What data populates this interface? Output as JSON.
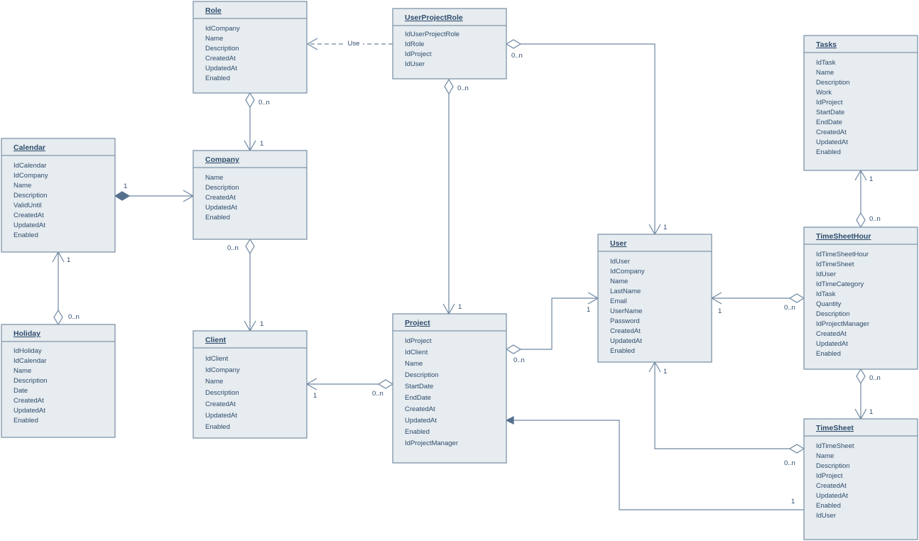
{
  "colors": {
    "box_fill": "#e6ecef",
    "box_border": "#7f95aa",
    "text": "#2e4b6d",
    "connector": "#6d86a0"
  },
  "classes": [
    {
      "id": "role",
      "name": "Role",
      "attributes": [
        "IdCompany",
        "Name",
        "Description",
        "CreatedAt",
        "UpdatedAt",
        "Enabled"
      ]
    },
    {
      "id": "userprojectrole",
      "name": "UserProjectRole",
      "attributes": [
        "IdUserProjectRole",
        "IdRole",
        "IdProject",
        "IdUser"
      ]
    },
    {
      "id": "tasks",
      "name": "Tasks",
      "attributes": [
        "IdTask",
        "Name",
        "Description",
        "Work",
        "IdProject",
        "StartDate",
        "EndDate",
        "CreatedAt",
        "UpdatedAt",
        "Enabled"
      ]
    },
    {
      "id": "calendar",
      "name": "Calendar",
      "attributes": [
        "IdCalendar",
        "IdCompany",
        "Name",
        "Description",
        "ValidUntil",
        "CreatedAt",
        "UpdatedAt",
        "Enabled"
      ]
    },
    {
      "id": "company",
      "name": "Company",
      "attributes": [
        "Name",
        "Description",
        "CreatedAt",
        "UpdatedAt",
        "Enabled"
      ]
    },
    {
      "id": "holiday",
      "name": "Holiday",
      "attributes": [
        "IdHoliday",
        "IdCalendar",
        "Name",
        "Description",
        "Date",
        "CreatedAt",
        "UpdatedAt",
        "Enabled"
      ]
    },
    {
      "id": "client",
      "name": "Client",
      "attributes": [
        "IdClient",
        "IdCompany",
        "Name",
        "Description",
        "CreatedAt",
        "UpdatedAt",
        "Enabled"
      ]
    },
    {
      "id": "project",
      "name": "Project",
      "attributes": [
        "IdProject",
        "IdClient",
        "Name",
        "Description",
        "StartDate",
        "EndDate",
        "CreatedAt",
        "UpdatedAt",
        "Enabled",
        "IdProjectManager"
      ]
    },
    {
      "id": "user",
      "name": "User",
      "attributes": [
        "IdUser",
        "IdCompany",
        "Name",
        "LastName",
        "Email",
        "UserName",
        "Password",
        "CreatedAt",
        "UpdatedAt",
        "Enabled"
      ]
    },
    {
      "id": "timesheethour",
      "name": "TimeSheetHour",
      "attributes": [
        "IdTimeSheetHour",
        "IdTimeSheet",
        "IdUser",
        "IdTimeCategory",
        "IdTask",
        "Quantity",
        "Description",
        "IdProjectManager",
        "CreatedAt",
        "UpdatedAt",
        "Enabled"
      ]
    },
    {
      "id": "timesheet",
      "name": "TimeSheet",
      "attributes": [
        "IdTimeSheet",
        "Name",
        "Description",
        "IdProject",
        "CreatedAt",
        "UpdatedAt",
        "Enabled",
        "IdUser"
      ]
    }
  ],
  "relationships": [
    {
      "id": "upr-role",
      "from": "UserProjectRole",
      "to": "Role",
      "kind": "dependency",
      "labels": [
        "Use"
      ]
    },
    {
      "id": "upr-user",
      "from": "UserProjectRole",
      "to": "User",
      "kind": "aggregation",
      "labels": [
        "0..n",
        "1"
      ]
    },
    {
      "id": "upr-project",
      "from": "UserProjectRole",
      "to": "Project",
      "kind": "aggregation",
      "labels": [
        "0..n",
        "1"
      ]
    },
    {
      "id": "role-company",
      "from": "Role",
      "to": "Company",
      "kind": "aggregation",
      "labels": [
        "0..n",
        "1"
      ]
    },
    {
      "id": "calendar-company",
      "from": "Calendar",
      "to": "Company",
      "kind": "composition",
      "labels": [
        "1"
      ]
    },
    {
      "id": "company-client",
      "from": "Company",
      "to": "Client",
      "kind": "aggregation",
      "labels": [
        "0..n",
        "1"
      ]
    },
    {
      "id": "holiday-calendar",
      "from": "Holiday",
      "to": "Calendar",
      "kind": "aggregation",
      "labels": [
        "0..n",
        "1"
      ]
    },
    {
      "id": "project-client",
      "from": "Project",
      "to": "Client",
      "kind": "aggregation",
      "labels": [
        "0..n",
        "1"
      ]
    },
    {
      "id": "project-user",
      "from": "Project",
      "to": "User",
      "kind": "aggregation",
      "labels": [
        "0..n",
        "1"
      ]
    },
    {
      "id": "tsh-user",
      "from": "TimeSheetHour",
      "to": "User",
      "kind": "aggregation",
      "labels": [
        "0..n",
        "1"
      ]
    },
    {
      "id": "tsh-tasks",
      "from": "TimeSheetHour",
      "to": "Tasks",
      "kind": "aggregation",
      "labels": [
        "0..n",
        "1"
      ]
    },
    {
      "id": "tsh-timesheet",
      "from": "TimeSheetHour",
      "to": "TimeSheet",
      "kind": "aggregation",
      "labels": [
        "0..n",
        "1"
      ]
    },
    {
      "id": "timesheet-user",
      "from": "TimeSheet",
      "to": "User",
      "kind": "aggregation",
      "labels": [
        "0..n",
        "1"
      ]
    },
    {
      "id": "timesheet-project",
      "from": "TimeSheet",
      "to": "Project",
      "kind": "association",
      "labels": [
        "1"
      ]
    }
  ]
}
